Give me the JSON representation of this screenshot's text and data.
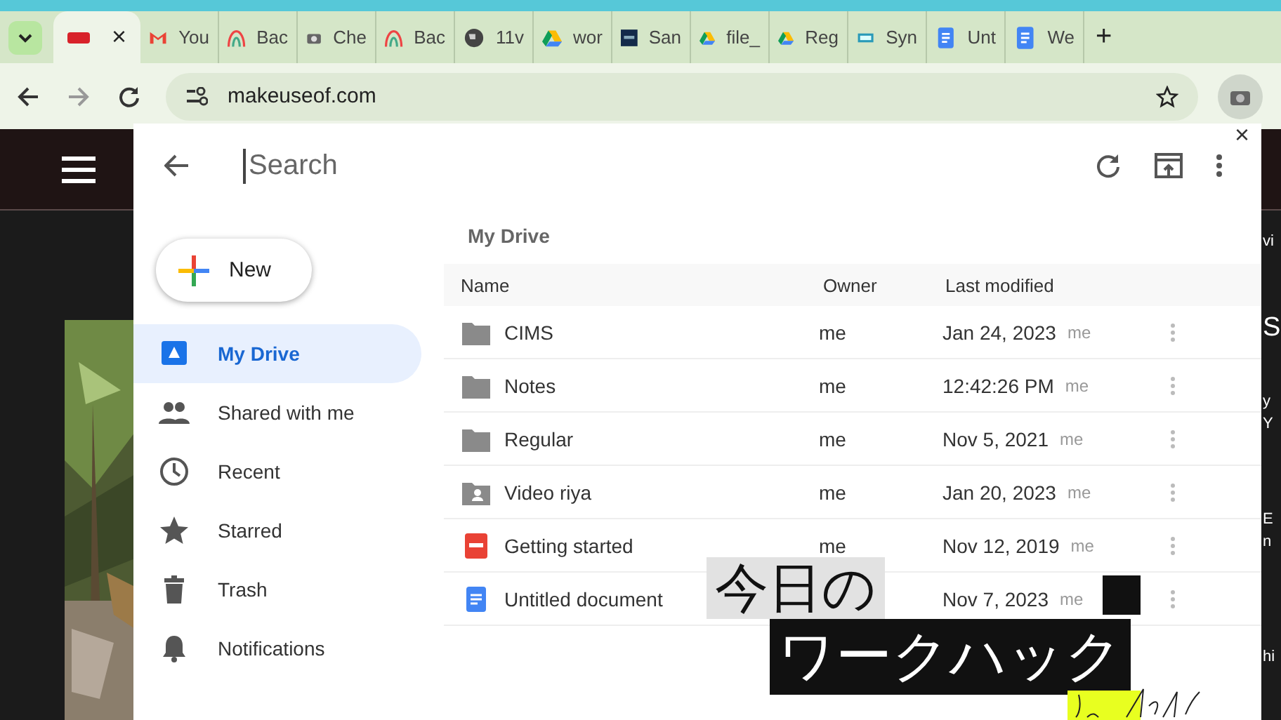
{
  "browser": {
    "tabs": [
      {
        "kind": "site",
        "selected": true,
        "close": "×"
      },
      {
        "label": "You",
        "kind": "gmail",
        "selected": false
      },
      {
        "label": "Bac",
        "kind": "rainbow",
        "selected": false
      },
      {
        "label": "Che",
        "kind": "camera",
        "selected": false
      },
      {
        "label": "Bac",
        "kind": "rainbow",
        "selected": false
      },
      {
        "label": "11v",
        "kind": "globe",
        "selected": false
      },
      {
        "label": "wor",
        "kind": "drive",
        "selected": false
      },
      {
        "label": "San",
        "kind": "square",
        "selected": false
      },
      {
        "label": "file_",
        "kind": "drive",
        "selected": false
      },
      {
        "label": "Reg",
        "kind": "drive",
        "selected": false
      },
      {
        "label": "Syn",
        "kind": "hq",
        "selected": false
      },
      {
        "label": "Unt",
        "kind": "doc",
        "selected": false
      },
      {
        "label": "We",
        "kind": "doc",
        "selected": false
      }
    ],
    "new_tab": "+",
    "address": "makeuseof.com"
  },
  "background_page": {
    "fragments": [
      "vi",
      "S",
      "y",
      "Y",
      "E",
      "n",
      "hi"
    ]
  },
  "dialog": {
    "search": {
      "placeholder": "Search"
    },
    "close": "×",
    "new_button": "New",
    "nav": [
      {
        "label": "My Drive",
        "kind": "drive",
        "selected": true
      },
      {
        "label": "Shared with me",
        "kind": "people",
        "selected": false
      },
      {
        "label": "Recent",
        "kind": "clock",
        "selected": false
      },
      {
        "label": "Starred",
        "kind": "star",
        "selected": false
      },
      {
        "label": "Trash",
        "kind": "trash",
        "selected": false
      },
      {
        "label": "Notifications",
        "kind": "bell",
        "selected": false
      }
    ],
    "breadcrumb": "My Drive",
    "table": {
      "columns": [
        "Name",
        "Owner",
        "Last modified"
      ],
      "rows": [
        {
          "name": "CIMS",
          "kind": "folder",
          "owner": "me",
          "modified": "Jan 24, 2023",
          "modified_by": "me"
        },
        {
          "name": "Notes",
          "kind": "folder",
          "owner": "me",
          "modified": "12:42:26 PM",
          "modified_by": "me"
        },
        {
          "name": "Regular",
          "kind": "folder",
          "owner": "me",
          "modified": "Nov 5, 2021",
          "modified_by": "me"
        },
        {
          "name": "Video riya",
          "kind": "shared_folder",
          "owner": "me",
          "modified": "Jan 20, 2023",
          "modified_by": "me"
        },
        {
          "name": "Getting started",
          "kind": "pdf",
          "owner": "me",
          "modified": "Nov 12, 2019",
          "modified_by": "me"
        },
        {
          "name": "Untitled document",
          "kind": "doc",
          "modified": "Nov 7, 2023",
          "modified_by": "me"
        }
      ]
    }
  },
  "caption": {
    "lines": [
      "今日の",
      "ワークハック"
    ]
  }
}
